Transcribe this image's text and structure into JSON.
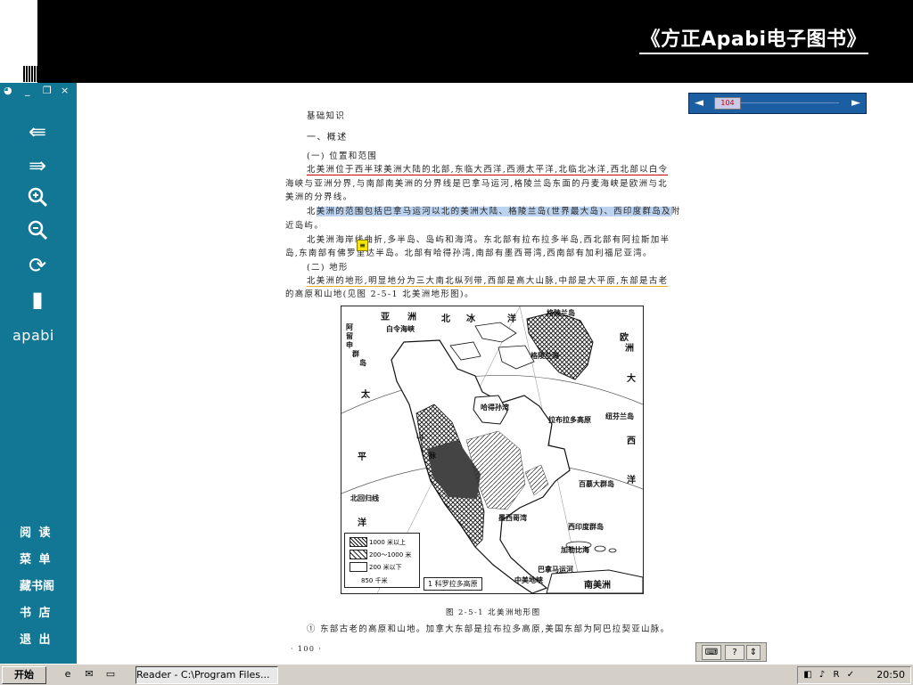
{
  "window": {
    "header_title": "《方正Apabi电子图书》",
    "controls": [
      "_",
      "❐",
      "×"
    ]
  },
  "sidebar": {
    "logo": "apabi",
    "menu": [
      "阅 读",
      "菜 单",
      "藏书阁",
      "书 店",
      "退 出"
    ]
  },
  "page_nav": {
    "prev": "◄",
    "page": "104",
    "next": "►"
  },
  "book": {
    "section_header": "基础知识",
    "heading1": "一、概述",
    "heading2": "(一) 位置和范围",
    "p1_lines": [
      "北美洲位于西半球美洲大陆的北部,东临大西洋,西濒太平洋,北临北冰洋,西北部以白令",
      "海峡与亚洲分界,与南部南美洲的分界线是巴拿马运河,格陵兰岛东面的丹麦海峡是欧洲与北",
      "美洲的分界线。"
    ],
    "p2_pre": "北",
    "p2_highlight": "美洲的范围包括巴拿马运河以北的美洲大陆、格陵兰岛(世界最大岛)、西印度群岛及",
    "p2_post": "附",
    "p2_line2": "近岛屿。",
    "p3_lines": [
      "北美洲海岸线曲折,多半岛、岛屿和海湾。东北部有拉布拉多半岛,西北部有阿拉斯加半",
      "岛,东南部有佛罗里达半岛。北部有哈得孙湾,南部有墨西哥湾,西南部有加利福尼亚湾。"
    ],
    "heading3": "(二) 地形",
    "p4_line1": "北美洲的地形,明显地分为三大南北纵列带,西部是高大山脉,中部是大平原,东部是古老",
    "p4_line2": "的高原和山地(见图 2-5-1 北美洲地形图)。",
    "caption": "图 2-5-1  北美洲地形图",
    "footnote": "① 东部古老的高原和山地。加拿大东部是拉布拉多高原,美国东部为阿巴拉契亚山脉。",
    "page_number": "· 100 ·"
  },
  "map": {
    "labels": [
      "亚",
      "洲",
      "北",
      "冰",
      "洋",
      "格陵兰岛",
      "欧",
      "洲",
      "阿",
      "留",
      "申",
      "群",
      "岛",
      "白令海峡",
      "格陵兰海",
      "大",
      "西",
      "洋",
      "太",
      "平",
      "洋",
      "哈得孙湾",
      "拉布拉多高原",
      "纽芬兰岛",
      "百慕大群岛",
      "墨西哥湾",
      "西印度群岛",
      "加勒比海",
      "南美洲",
      "北回归线",
      "巴拿马运河",
      "中美地峡",
      "山",
      "脉"
    ],
    "legend": [
      "1000 米以上",
      "200～1000 米",
      "200 米以下"
    ],
    "scale": "850 千米",
    "mountain": "1 科罗拉多高原"
  },
  "taskbar": {
    "start": "开始",
    "task": "Reader - C:\\Program Files...",
    "time": "20:50"
  }
}
